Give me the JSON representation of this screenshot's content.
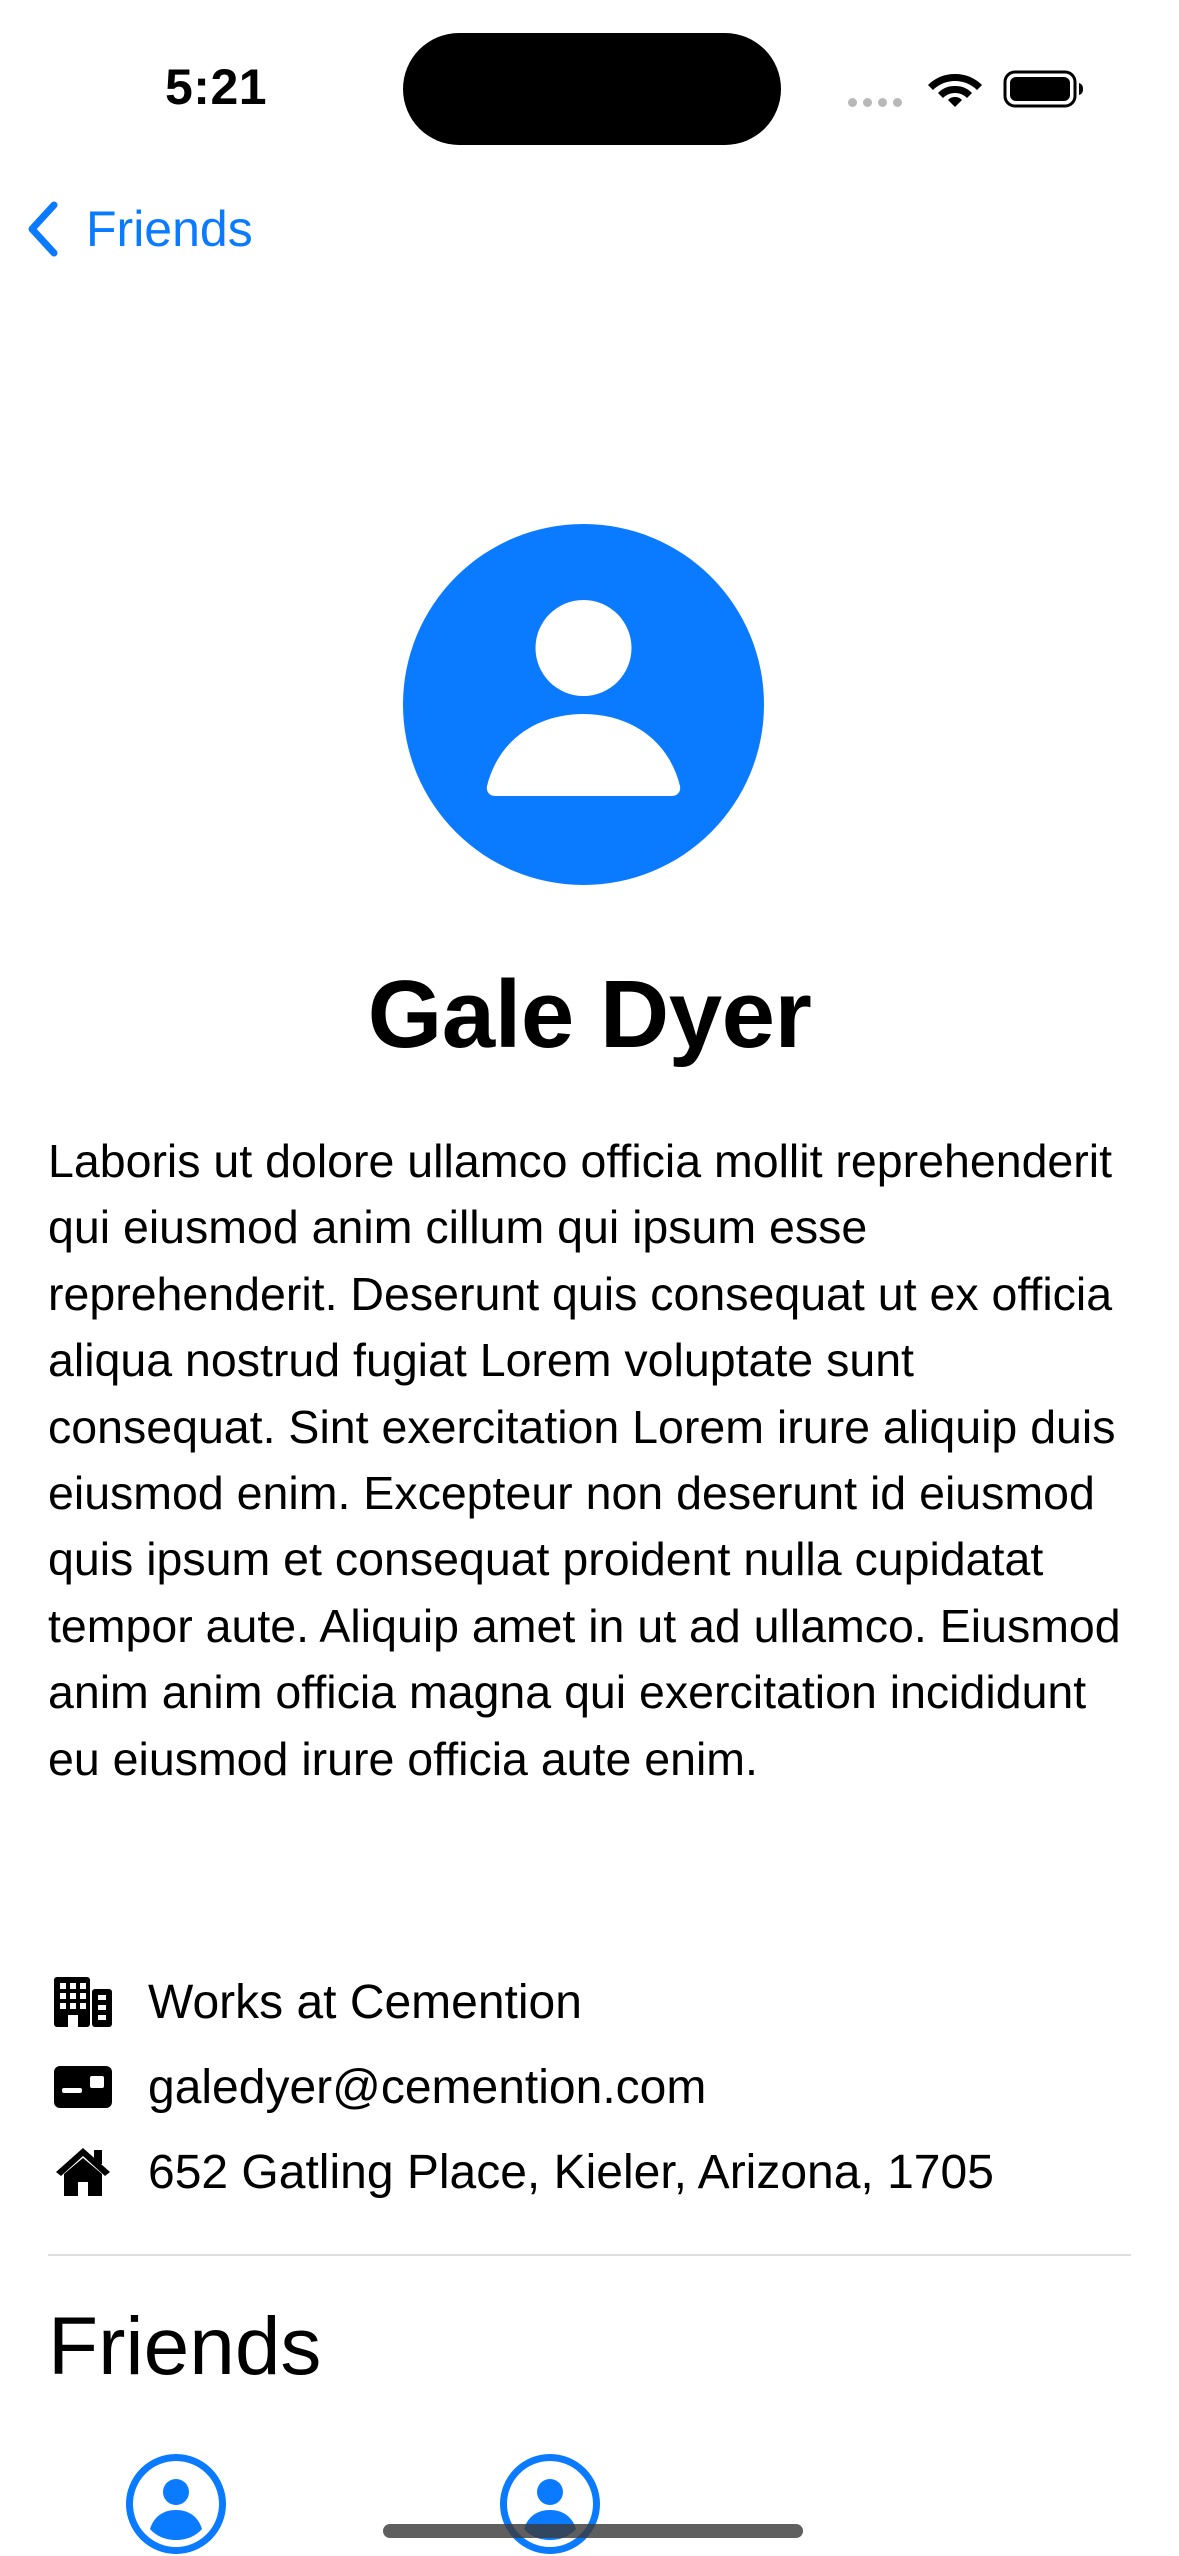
{
  "status_bar": {
    "time": "5:21",
    "icons": [
      "cellular-signal-icon",
      "wifi-icon",
      "battery-icon"
    ]
  },
  "nav": {
    "back_label": "Friends",
    "back_icon": "chevron-left-icon"
  },
  "profile": {
    "avatar_icon": "person-icon",
    "name": "Gale Dyer",
    "bio": "Laboris ut dolore ullamco officia mollit reprehenderit qui eiusmod anim cillum qui ipsum esse reprehenderit. Deserunt quis consequat ut ex officia aliqua nostrud fugiat Lorem voluptate sunt consequat. Sint exercitation Lorem irure aliquip duis eiusmod enim. Excepteur non deserunt id eiusmod quis ipsum et consequat proident nulla cupidatat tempor aute. Aliquip amet in ut ad ullamco. Eiusmod anim anim officia magna qui exercitation incididunt eu eiusmod irure officia aute enim.",
    "info": [
      {
        "icon": "building-icon",
        "text": "Works at Cemention"
      },
      {
        "icon": "id-card-icon",
        "text": "galedyer@cemention.com"
      },
      {
        "icon": "house-icon",
        "text": "652 Gatling Place, Kieler, Arizona, 1705"
      }
    ]
  },
  "friends": {
    "heading": "Friends",
    "avatar_icon": "person-circle-icon"
  },
  "colors": {
    "accent": "#0a7bff",
    "background": "#ffffff",
    "text": "#000000",
    "divider": "#dedede"
  }
}
